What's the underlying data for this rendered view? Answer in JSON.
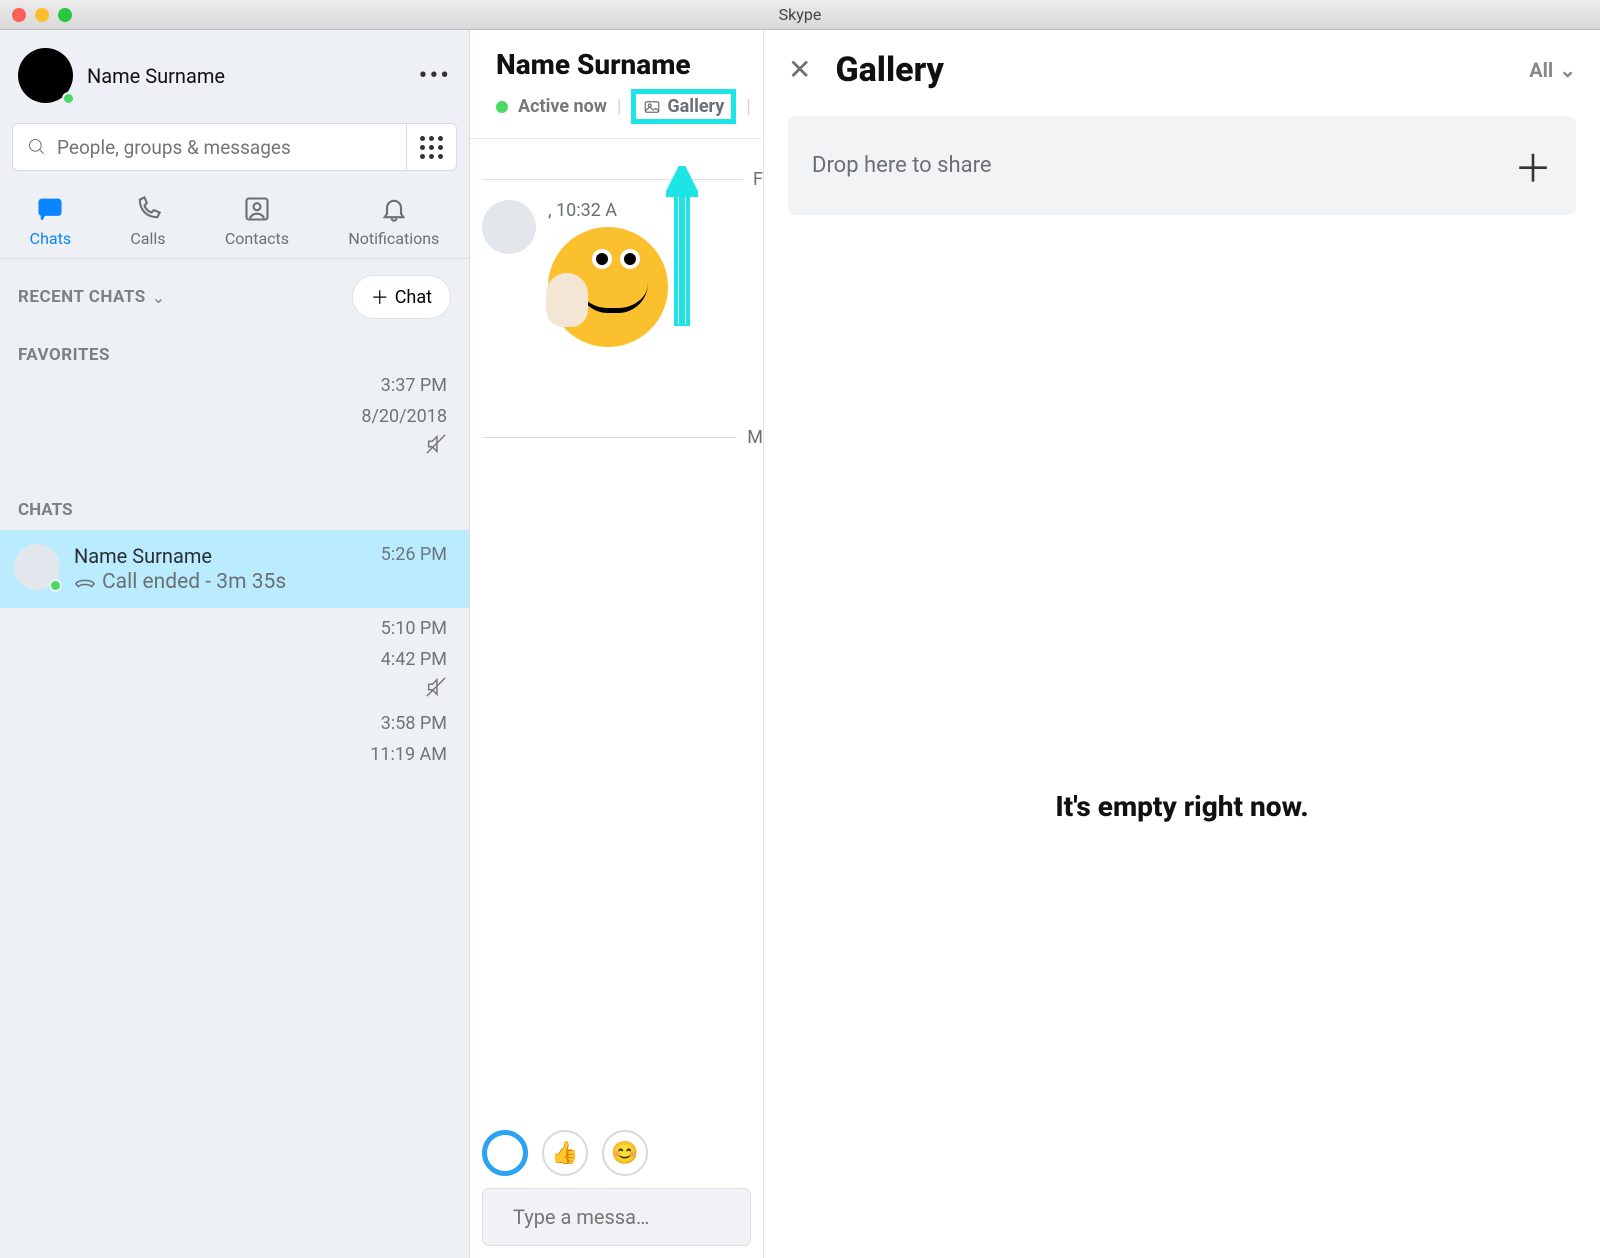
{
  "window": {
    "title": "Skype"
  },
  "sidebar": {
    "profile_name": "Name Surname",
    "search_placeholder": "People, groups & messages",
    "nav": {
      "chats": "Chats",
      "calls": "Calls",
      "contacts": "Contacts",
      "notifications": "Notifications"
    },
    "recent_label": "RECENT CHATS",
    "new_chat": "Chat",
    "favorites_label": "FAVORITES",
    "chats_label": "CHATS",
    "timestamps": {
      "t1": "3:37 PM",
      "t2": "8/20/2018",
      "t3": "5:10 PM",
      "t4": "4:42 PM",
      "t5": "3:58 PM",
      "t6": "11:19 AM"
    },
    "active_chat": {
      "name": "Name Surname",
      "sub": "Call ended - 3m 35s",
      "time": "5:26 PM"
    }
  },
  "chat": {
    "title": "Name Surname",
    "status": "Active now",
    "gallery_link": "Gallery",
    "divider1": "F",
    "msg_time": ", 10:32 A",
    "divider2": "M",
    "input_placeholder": "Type a messa…"
  },
  "gallery": {
    "title": "Gallery",
    "filter": "All",
    "drop_text": "Drop here to share",
    "empty_text": "It's empty right now."
  }
}
